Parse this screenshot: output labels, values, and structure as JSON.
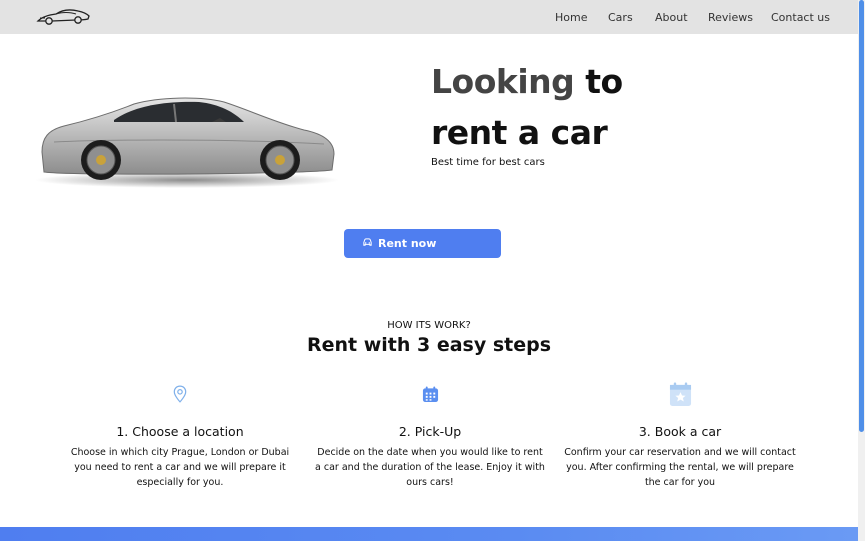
{
  "nav": {
    "logo_icon": "sports-car-logo-icon",
    "items": [
      {
        "label": "Home"
      },
      {
        "label": "Cars"
      },
      {
        "label": "About"
      },
      {
        "label": "Reviews"
      },
      {
        "label": "Contact us"
      }
    ]
  },
  "hero": {
    "title_part1": "Looking",
    "title_part2": "to",
    "title_line2": "rent a car",
    "subtitle": "Best time for best cars",
    "image_icon": "silver-sports-car-image",
    "cta_label": "Rent now",
    "cta_icon": "car-icon"
  },
  "how": {
    "label": "HOW ITS WORK?",
    "title": "Rent with 3 easy steps",
    "steps": [
      {
        "icon": "location-pin-icon",
        "title": "1. Choose a location",
        "description": "Choose in which city Prague, London or Dubai you need to rent a car and we will prepare it especially for you."
      },
      {
        "icon": "calendar-icon",
        "title": "2. Pick-Up",
        "description": "Decide on the date when you would like to rent a car and the duration of the lease. Enjoy it with ours cars!"
      },
      {
        "icon": "calendar-star-icon",
        "title": "3. Book a car",
        "description": "Confirm your car reservation and we will contact you. After confirming the rental, we will prepare the car for you"
      }
    ]
  },
  "colors": {
    "accent": "#4f7ef0",
    "nav_bg": "#e3e3e3",
    "icon_light": "#9ec2ee",
    "icon_mid": "#5b8ff0"
  }
}
